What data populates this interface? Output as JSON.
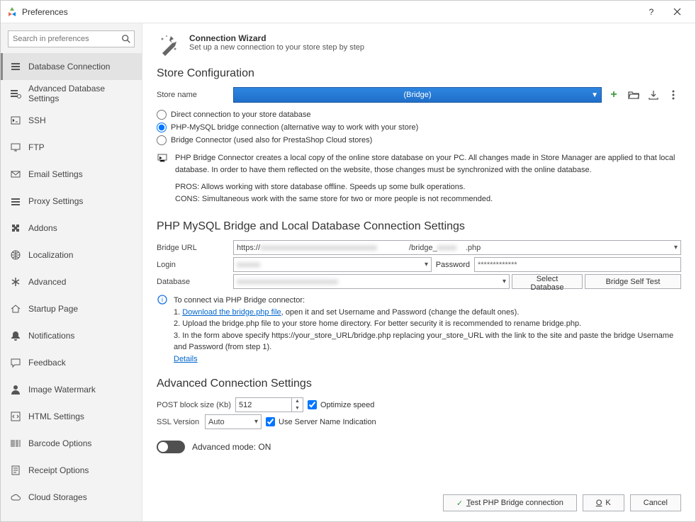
{
  "window": {
    "title": "Preferences"
  },
  "search": {
    "placeholder": "Search in preferences"
  },
  "sidebar": {
    "items": [
      {
        "label": "Database Connection",
        "icon": "db"
      },
      {
        "label": "Advanced Database Settings",
        "icon": "dbadv"
      },
      {
        "label": "SSH",
        "icon": "terminal"
      },
      {
        "label": "FTP",
        "icon": "monitor"
      },
      {
        "label": "Email Settings",
        "icon": "mail"
      },
      {
        "label": "Proxy Settings",
        "icon": "proxy"
      },
      {
        "label": "Addons",
        "icon": "puzzle"
      },
      {
        "label": "Localization",
        "icon": "globe"
      },
      {
        "label": "Advanced",
        "icon": "asterisk"
      },
      {
        "label": "Startup Page",
        "icon": "home"
      },
      {
        "label": "Notifications",
        "icon": "bell"
      },
      {
        "label": "Feedback",
        "icon": "chat"
      },
      {
        "label": "Image Watermark",
        "icon": "person"
      },
      {
        "label": "HTML Settings",
        "icon": "html"
      },
      {
        "label": "Barcode Options",
        "icon": "barcode"
      },
      {
        "label": "Receipt Options",
        "icon": "receipt"
      },
      {
        "label": "Cloud Storages",
        "icon": "cloud"
      }
    ],
    "selected_index": 0
  },
  "wizard": {
    "title": "Connection Wizard",
    "desc": "Set up a new connection to your store step by step"
  },
  "store_config": {
    "heading": "Store Configuration",
    "name_label": "Store name",
    "name_value": "(Bridge)",
    "radios": {
      "direct": "Direct connection to your store database",
      "bridge": "PHP-MySQL bridge connection (alternative way to work with your store)",
      "connector": "Bridge Connector (used also for PrestaShop Cloud stores)"
    },
    "info1": "PHP Bridge Connector creates a local copy of the online store database on your PC. All changes made in Store Manager are applied to that local database. In order to have them reflected on the website, those changes must be synchronized with the online database.",
    "info_pros": "PROS: Allows working with store database offline. Speeds up some bulk operations.",
    "info_cons": "CONS: Simultaneous work with the same store for two or more people is not recommended."
  },
  "bridge": {
    "heading": "PHP MySQL Bridge and Local Database Connection Settings",
    "url_label": "Bridge URL",
    "url_prefix": "https://",
    "url_mid": "/bridge_",
    "url_suffix": ".php",
    "login_label": "Login",
    "login_value": "",
    "password_label": "Password",
    "password_value": "*************",
    "database_label": "Database",
    "database_value": "",
    "select_db_btn": "Select Database",
    "self_test_btn": "Bridge Self Test",
    "help_intro": "To connect via PHP Bridge connector:",
    "help_1a": "1. ",
    "help_1_link": "Download the bridge.php file",
    "help_1b": ", open it and set Username and Password (change the default ones).",
    "help_2": "2. Upload the bridge.php file to your store home directory. For better security it is recommended to rename bridge.php.",
    "help_3": "3. In the form above specify https://your_store_URL/bridge.php replacing your_store_URL with the link to the site and paste the bridge Username and Password (from step 1).",
    "help_details": "Details"
  },
  "advanced": {
    "heading": "Advanced Connection Settings",
    "post_label": "POST block size (Kb)",
    "post_value": "512",
    "optimize": "Optimize speed",
    "ssl_label": "SSL Version",
    "ssl_value": "Auto",
    "sni": "Use Server Name Indication",
    "mode_label": "Advanced mode: ON"
  },
  "footer": {
    "test": "Test PHP Bridge connection",
    "ok": "OK",
    "cancel": "Cancel"
  }
}
